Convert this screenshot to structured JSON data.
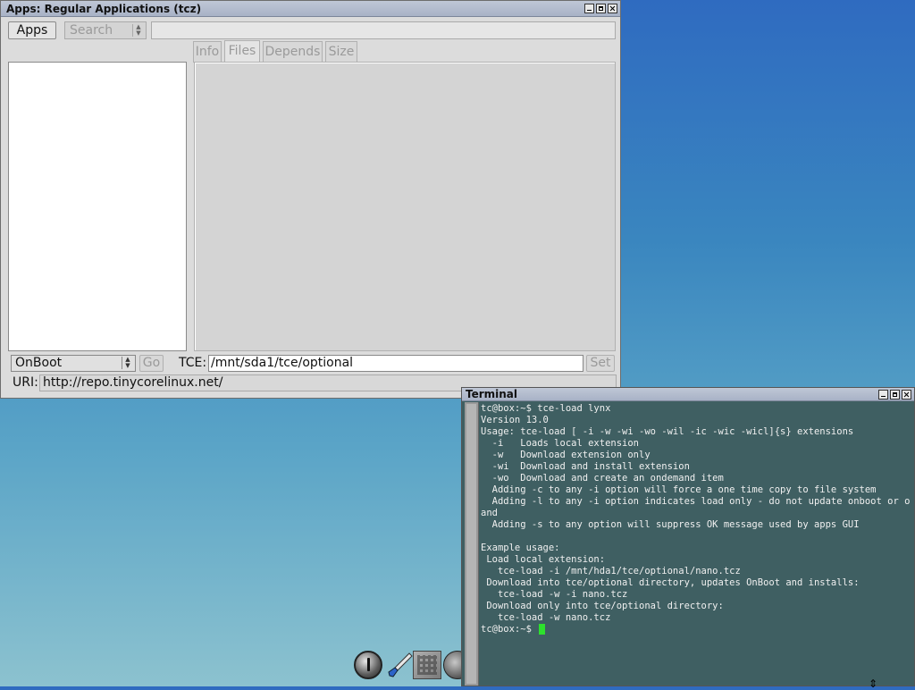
{
  "apps_window": {
    "title": "Apps: Regular Applications (tcz)",
    "apps_button": "Apps",
    "search_mode": "Search",
    "search_value": "",
    "tabs": [
      {
        "label": "Info"
      },
      {
        "label": "Files"
      },
      {
        "label": "Depends"
      },
      {
        "label": "Size"
      }
    ],
    "active_tab": "Files",
    "install_mode": "OnBoot",
    "go_label": "Go",
    "tce_label": "TCE:",
    "tce_path": "/mnt/sda1/tce/optional",
    "set_label": "Set",
    "uri_label": "URI:",
    "uri_value": "http://repo.tinycorelinux.net/"
  },
  "terminal": {
    "title": "Terminal",
    "lines": [
      "tc@box:~$ tce-load lynx",
      "Version 13.0",
      "Usage: tce-load [ -i -w -wi -wo -wil -ic -wic -wicl]{s} extensions",
      "  -i   Loads local extension",
      "  -w   Download extension only",
      "  -wi  Download and install extension",
      "  -wo  Download and create an ondemand item",
      "  Adding -c to any -i option will force a one time copy to file system",
      "  Adding -l to any -i option indicates load only - do not update onboot or ondem",
      "and",
      "  Adding -s to any option will suppress OK message used by apps GUI",
      "",
      "Example usage:",
      " Load local extension:",
      "   tce-load -i /mnt/hda1/tce/optional/nano.tcz",
      " Download into tce/optional directory, updates OnBoot and installs:",
      "   tce-load -w -i nano.tcz",
      " Download only into tce/optional directory:",
      "   tce-load -w nano.tcz"
    ],
    "prompt": "tc@box:~$ ",
    "cursor_color": "#2de12d"
  },
  "dock": {
    "icons": [
      "power-icon",
      "paint-brush-icon",
      "calculator-icon",
      "globe-icon"
    ]
  }
}
